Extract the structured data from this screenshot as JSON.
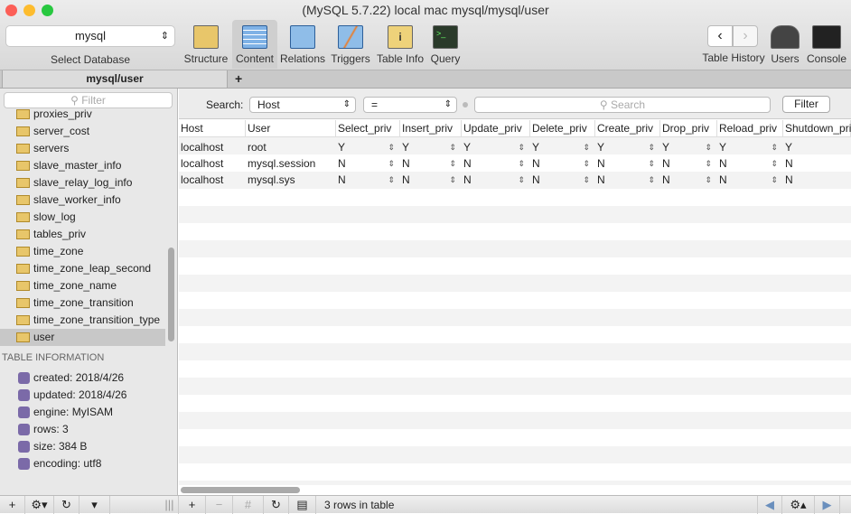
{
  "window": {
    "title": "(MySQL 5.7.22) local mac mysql/mysql/user"
  },
  "toolbar": {
    "database": "mysql",
    "select_database": "Select Database",
    "buttons": [
      {
        "label": "Structure"
      },
      {
        "label": "Content"
      },
      {
        "label": "Relations"
      },
      {
        "label": "Triggers"
      },
      {
        "label": "Table Info"
      },
      {
        "label": "Query"
      }
    ],
    "right": [
      {
        "label": "Table History"
      },
      {
        "label": "Users"
      },
      {
        "label": "Console"
      }
    ]
  },
  "tabs": {
    "active": "mysql/user",
    "add": "+"
  },
  "sidebar": {
    "filter_placeholder": "Filter",
    "tables": [
      "proxies_priv",
      "server_cost",
      "servers",
      "slave_master_info",
      "slave_relay_log_info",
      "slave_worker_info",
      "slow_log",
      "tables_priv",
      "time_zone",
      "time_zone_leap_second",
      "time_zone_name",
      "time_zone_transition",
      "time_zone_transition_type",
      "user"
    ],
    "selected": "user",
    "info_heading": "TABLE INFORMATION",
    "info": [
      "created: 2018/4/26",
      "updated: 2018/4/26",
      "engine: MyISAM",
      "rows: 3",
      "size: 384 B",
      "encoding: utf8"
    ]
  },
  "search": {
    "label": "Search:",
    "field": "Host",
    "operator": "=",
    "placeholder": "Search",
    "button": "Filter"
  },
  "table": {
    "columns": [
      "Host",
      "User",
      "Select_priv",
      "Insert_priv",
      "Update_priv",
      "Delete_priv",
      "Create_priv",
      "Drop_priv",
      "Reload_priv",
      "Shutdown_priv"
    ],
    "rows": [
      [
        "localhost",
        "root",
        "Y",
        "Y",
        "Y",
        "Y",
        "Y",
        "Y",
        "Y",
        "Y"
      ],
      [
        "localhost",
        "mysql.session",
        "N",
        "N",
        "N",
        "N",
        "N",
        "N",
        "N",
        "N"
      ],
      [
        "localhost",
        "mysql.sys",
        "N",
        "N",
        "N",
        "N",
        "N",
        "N",
        "N",
        "N"
      ]
    ]
  },
  "status": {
    "rows_text": "3 rows in table"
  }
}
